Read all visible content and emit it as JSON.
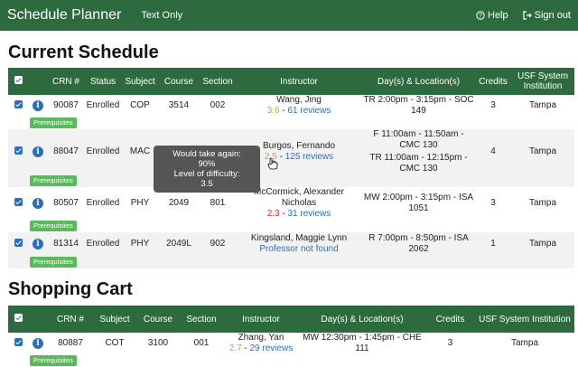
{
  "header": {
    "title": "Schedule Planner",
    "text_only": "Text Only",
    "help": "Help",
    "sign_out": "Sign out"
  },
  "current": {
    "heading": "Current Schedule",
    "columns": [
      "CRN #",
      "Status",
      "Subject",
      "Course",
      "Section",
      "Instructor",
      "Day(s) & Location(s)",
      "Credits",
      "USF System Institution"
    ],
    "prereq_label": "Prerequisites",
    "rows": [
      {
        "crn": "90087",
        "status": "Enrolled",
        "subject": "COP",
        "course": "3514",
        "section": "002",
        "instructor": "Wang, Jing",
        "rating": "3.6",
        "reviews": "61 reviews",
        "locations": [
          "TR 2:00pm - 3:15pm - SOC 149"
        ],
        "credits": "3",
        "institution": "Tampa"
      },
      {
        "crn": "88047",
        "status": "Enrolled",
        "subject": "MAC",
        "course": "",
        "section": "",
        "instructor": "Burgos, Fernando",
        "rating": "2.5",
        "reviews": "125 reviews",
        "locations": [
          "F 11:00am - 11:50am - CMC 130",
          "TR 11:00am - 12:15pm - CMC 130"
        ],
        "credits": "4",
        "institution": "Tampa"
      },
      {
        "crn": "80507",
        "status": "Enrolled",
        "subject": "PHY",
        "course": "2049",
        "section": "801",
        "instructor": "McCormick, Alexander Nicholas",
        "rating": "2.3",
        "reviews": "31 reviews",
        "locations": [
          "MW 2:00pm - 3:15pm - ISA 1051"
        ],
        "credits": "3",
        "institution": "Tampa"
      },
      {
        "crn": "81314",
        "status": "Enrolled",
        "subject": "PHY",
        "course": "2049L",
        "section": "902",
        "instructor": "Kingsland, Maggie Lynn",
        "not_found": "Professor not found",
        "locations": [
          "R 7:00pm - 8:50pm - ISA 2062"
        ],
        "credits": "1",
        "institution": "Tampa"
      }
    ]
  },
  "tooltip": {
    "line1": "Would take again:",
    "line2": "90%",
    "line3": "Level of difficulty:",
    "line4": "3.5"
  },
  "cart": {
    "heading": "Shopping Cart",
    "columns": [
      "CRN #",
      "Subject",
      "Course",
      "Section",
      "Instructor",
      "Day(s) & Location(s)",
      "Credits",
      "USF System Institution"
    ],
    "prereq_label": "Prerequisites",
    "rows": [
      {
        "crn": "80887",
        "subject": "COT",
        "course": "3100",
        "section": "001",
        "instructor": "Zhang, Yan",
        "rating": "2.7",
        "reviews": "29 reviews",
        "location": "MW 12:30pm - 1:45pm - CHE 111",
        "credits": "3",
        "institution": "Tampa"
      }
    ]
  },
  "colors": {
    "header_green": "#2d6b3f",
    "prereq_green": "#5cb85c",
    "link_blue": "#2a6fb8",
    "rating_yellow": "#b8a94a",
    "rating_red": "#d03030"
  },
  "icons": [
    "help-icon",
    "sign-out-icon",
    "checkbox-icon",
    "info-icon",
    "hand-cursor-icon"
  ]
}
